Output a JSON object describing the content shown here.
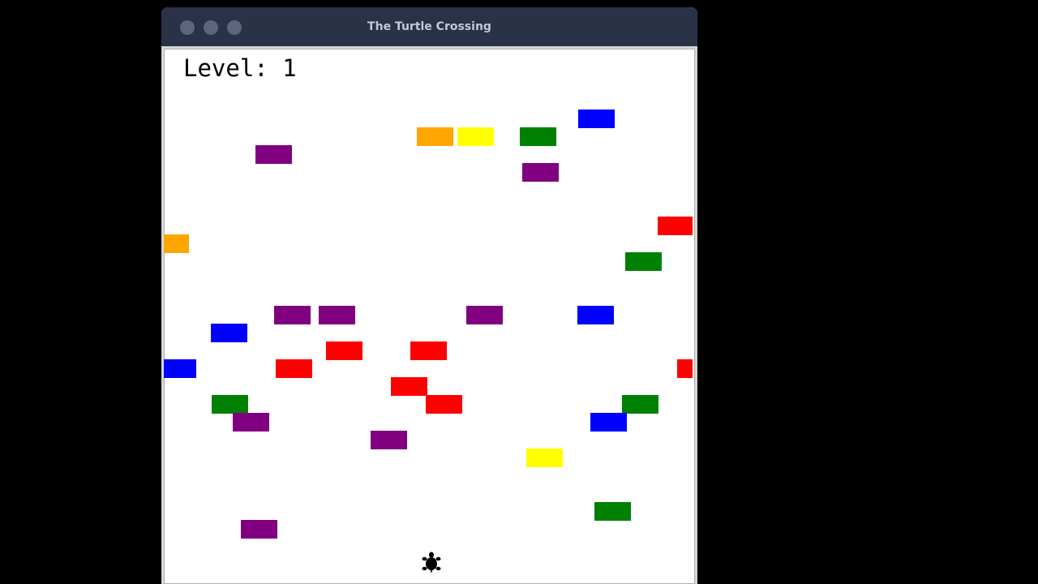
{
  "window": {
    "title": "The Turtle Crossing"
  },
  "hud": {
    "level_label": "Level:",
    "level_value": "1"
  },
  "colors": {
    "orange": "#ffa500",
    "yellow": "#ffff00",
    "green": "#008000",
    "blue": "#0000ff",
    "purple": "#800080",
    "red": "#ff0000"
  },
  "cars": [
    {
      "color": "orange",
      "lane": "lane-a"
    },
    {
      "color": "yellow",
      "lane": "lane-a"
    },
    {
      "color": "green",
      "lane": "lane-a"
    },
    {
      "color": "blue",
      "lane": "lane-b"
    },
    {
      "color": "purple",
      "lane": "lane-c"
    },
    {
      "color": "purple",
      "lane": "lane-d"
    },
    {
      "color": "red",
      "lane": "lane-e"
    },
    {
      "color": "orange",
      "lane": "lane-f"
    },
    {
      "color": "green",
      "lane": "lane-g"
    },
    {
      "color": "purple",
      "lane": "lane-h"
    },
    {
      "color": "purple",
      "lane": "lane-h"
    },
    {
      "color": "purple",
      "lane": "lane-h"
    },
    {
      "color": "blue",
      "lane": "lane-h"
    },
    {
      "color": "blue",
      "lane": "lane-i"
    },
    {
      "color": "red",
      "lane": "lane-j"
    },
    {
      "color": "red",
      "lane": "lane-j"
    },
    {
      "color": "blue",
      "lane": "lane-k"
    },
    {
      "color": "red",
      "lane": "lane-k"
    },
    {
      "color": "red",
      "lane": "lane-k"
    },
    {
      "color": "red",
      "lane": "lane-l"
    },
    {
      "color": "green",
      "lane": "lane-m"
    },
    {
      "color": "red",
      "lane": "lane-m"
    },
    {
      "color": "green",
      "lane": "lane-m"
    },
    {
      "color": "purple",
      "lane": "lane-n"
    },
    {
      "color": "blue",
      "lane": "lane-n"
    },
    {
      "color": "purple",
      "lane": "lane-o"
    },
    {
      "color": "yellow",
      "lane": "lane-p"
    },
    {
      "color": "green",
      "lane": "lane-q"
    },
    {
      "color": "purple",
      "lane": "lane-r"
    }
  ],
  "player": {
    "icon": "turtle-icon",
    "color": "#000000"
  }
}
